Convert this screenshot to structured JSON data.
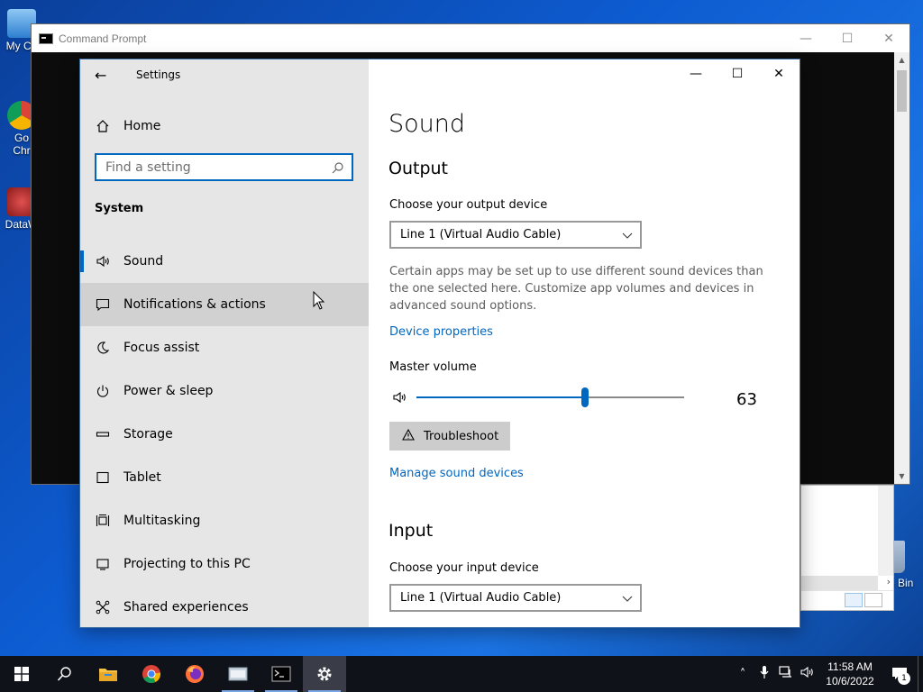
{
  "desktop": {
    "icons": [
      {
        "label": "My Co"
      },
      {
        "label": "Go\nChr"
      },
      {
        "label": "DataW"
      }
    ],
    "recycle_label": "e Bin"
  },
  "cmd": {
    "title": "Command Prompt"
  },
  "settings": {
    "app_title": "Settings",
    "home_label": "Home",
    "search_placeholder": "Find a setting",
    "section": "System",
    "nav_items": [
      {
        "label": "Sound",
        "icon": "speaker-icon"
      },
      {
        "label": "Notifications & actions",
        "icon": "notification-icon"
      },
      {
        "label": "Focus assist",
        "icon": "moon-icon"
      },
      {
        "label": "Power & sleep",
        "icon": "power-icon"
      },
      {
        "label": "Storage",
        "icon": "storage-icon"
      },
      {
        "label": "Tablet",
        "icon": "tablet-icon"
      },
      {
        "label": "Multitasking",
        "icon": "multitasking-icon"
      },
      {
        "label": "Projecting to this PC",
        "icon": "projector-icon"
      },
      {
        "label": "Shared experiences",
        "icon": "shared-icon"
      }
    ],
    "page_title": "Sound",
    "output": {
      "heading": "Output",
      "device_label": "Choose your output device",
      "device_value": "Line 1 (Virtual Audio Cable)",
      "description": "Certain apps may be set up to use different sound devices than the one selected here. Customize app volumes and devices in advanced sound options.",
      "device_properties_link": "Device properties",
      "master_volume_label": "Master volume",
      "volume": 63,
      "troubleshoot_label": "Troubleshoot",
      "manage_link": "Manage sound devices"
    },
    "input": {
      "heading": "Input",
      "device_label": "Choose your input device",
      "device_value": "Line 1 (Virtual Audio Cable)"
    }
  },
  "taskbar": {
    "time": "11:58 AM",
    "date": "10/6/2022",
    "notification_count": "1"
  },
  "colors": {
    "accent": "#0067c0",
    "nav_bg": "#e6e6e6",
    "taskbar": "#10121a"
  }
}
